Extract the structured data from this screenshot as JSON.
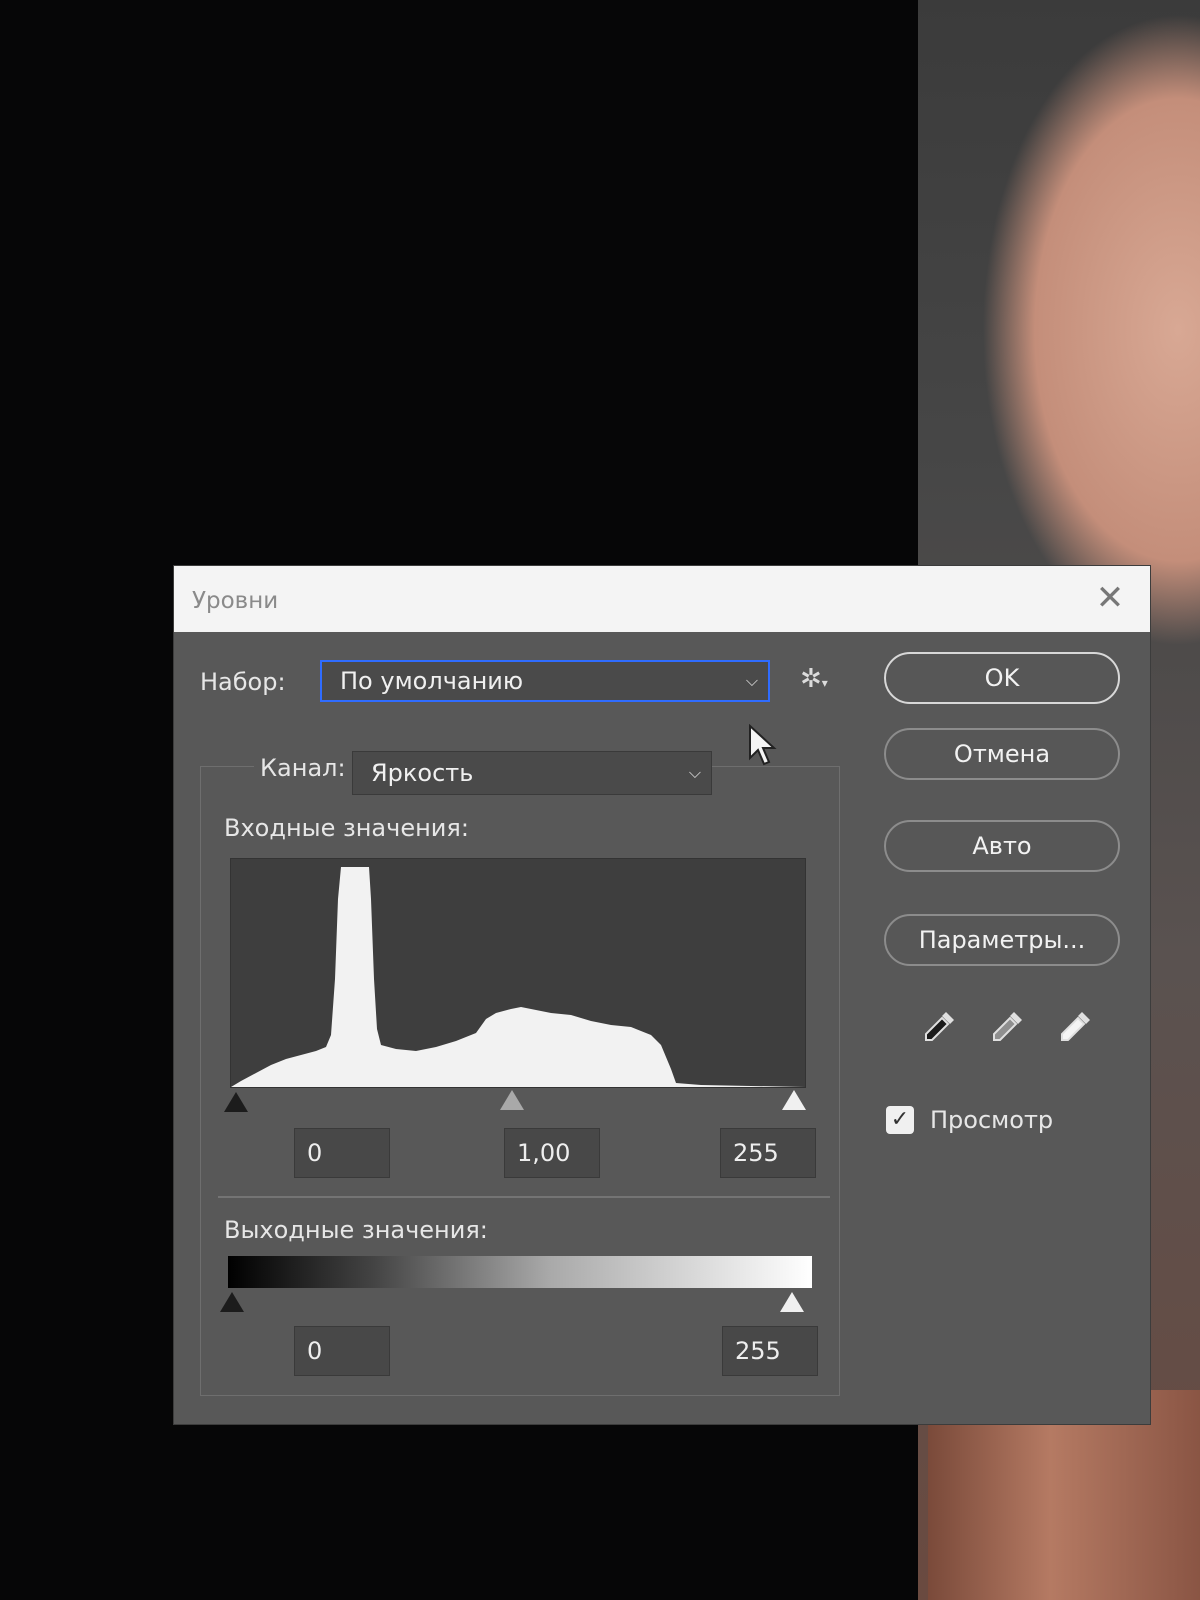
{
  "dialog": {
    "title": "Уровни",
    "preset_label": "Набор:",
    "preset_value": "По умолчанию",
    "channel_label": "Канал:",
    "channel_value": "Яркость",
    "input_label": "Входные значения:",
    "input_black": "0",
    "input_gamma": "1,00",
    "input_white": "255",
    "output_label": "Выходные значения:",
    "output_black": "0",
    "output_white": "255",
    "buttons": {
      "ok": "OK",
      "cancel": "Отмена",
      "auto": "Авто",
      "options": "Параметры..."
    },
    "preview_label": "Просмотр",
    "preview_checked": true
  },
  "icons": {
    "close": "close-icon",
    "gear": "gear-icon",
    "chevron": "chevron-down-icon",
    "eyedropper_black": "eyedropper-black-icon",
    "eyedropper_gray": "eyedropper-gray-icon",
    "eyedropper_white": "eyedropper-white-icon",
    "cursor": "mouse-cursor-icon"
  }
}
